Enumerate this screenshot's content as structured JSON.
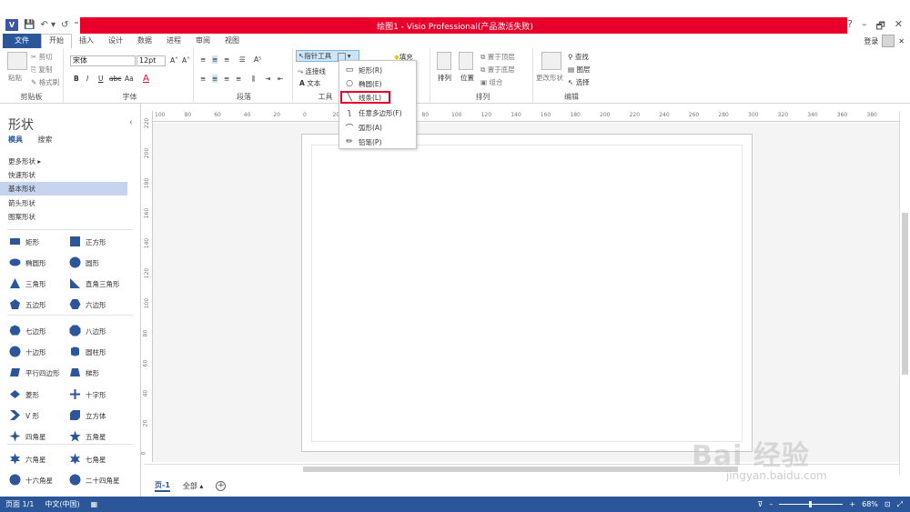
{
  "window": {
    "title": "绘图1 - Visio Professional(产品激活失败)",
    "controls": [
      "?",
      "–",
      "🗗",
      "✕"
    ]
  },
  "qat": {
    "logo": "V",
    "save": "💾",
    "undo": "↶ ▾",
    "redo": "↺",
    "more": "⁼"
  },
  "tabs": [
    {
      "label": "文件",
      "kind": "file"
    },
    {
      "label": "开始",
      "kind": "active"
    },
    {
      "label": "插入"
    },
    {
      "label": "设计"
    },
    {
      "label": "数据"
    },
    {
      "label": "进程"
    },
    {
      "label": "审阅"
    },
    {
      "label": "视图"
    }
  ],
  "account": {
    "signin": "登录",
    "close": "✕"
  },
  "ribbon": {
    "clipboard": {
      "label": "剪贴板",
      "paste": "粘贴",
      "cut": "剪切",
      "copy": "复制",
      "format_painter": "格式刷"
    },
    "font": {
      "label": "字体",
      "font_name": "宋体",
      "font_size": "12pt",
      "bold": "B",
      "italic": "I",
      "underline": "U",
      "strike": "abc",
      "case": "Aa",
      "color": "A",
      "grow": "A˄",
      "shrink": "A˅"
    },
    "paragraph": {
      "label": "段落"
    },
    "tools": {
      "label": "工具",
      "pointer": "指针工具",
      "connector": "连接线",
      "text": "文本"
    },
    "shape_styles": {
      "fill": "填充"
    },
    "arrange": {
      "label": "排列",
      "arrange": "排列",
      "position": "位置",
      "bring_front": "置于顶层",
      "send_back": "置于底层",
      "group": "组合"
    },
    "editing": {
      "label": "编辑",
      "change_shape": "更改形状",
      "find": "查找",
      "layers": "图层",
      "select": "选择"
    }
  },
  "dropdown": [
    {
      "label": "矩形(R)",
      "icon": "rectangle-icon"
    },
    {
      "label": "椭圆(E)",
      "icon": "ellipse-icon"
    },
    {
      "label": "线条(L)",
      "icon": "line-icon",
      "highlighted": true
    },
    {
      "label": "任意多边形(F)",
      "icon": "freeform-icon"
    },
    {
      "label": "弧形(A)",
      "icon": "arc-icon"
    },
    {
      "label": "铅笔(P)",
      "icon": "pencil-icon"
    }
  ],
  "shapes_panel": {
    "title": "形状",
    "tabs": [
      "模具",
      "搜索"
    ],
    "stencils": [
      "更多形状",
      "快速形状",
      "基本形状",
      "箭头形状",
      "图案形状"
    ],
    "selected_stencil": "基本形状",
    "shapes": [
      {
        "label": "矩形"
      },
      {
        "label": "正方形"
      },
      {
        "label": "椭圆形"
      },
      {
        "label": "圆形"
      },
      {
        "label": "三角形"
      },
      {
        "label": "直角三角形"
      },
      {
        "label": "五边形"
      },
      {
        "label": "六边形"
      },
      {
        "label": "七边形"
      },
      {
        "label": "八边形"
      },
      {
        "label": "十边形"
      },
      {
        "label": "圆柱形"
      },
      {
        "label": "平行四边形"
      },
      {
        "label": "梯形"
      },
      {
        "label": "菱形"
      },
      {
        "label": "十字形"
      },
      {
        "label": "V 形"
      },
      {
        "label": "立方体"
      },
      {
        "label": "四角星"
      },
      {
        "label": "五角星"
      },
      {
        "label": "六角星"
      },
      {
        "label": "七角星"
      },
      {
        "label": "十六角星"
      },
      {
        "label": "二十四角星"
      }
    ]
  },
  "rulers": {
    "horizontal": [
      "100",
      "80",
      "60",
      "40",
      "20",
      "0",
      "20",
      "40",
      "60",
      "80",
      "100",
      "120",
      "140",
      "160",
      "180",
      "200",
      "220",
      "240",
      "260",
      "280",
      "300",
      "320",
      "340",
      "360",
      "380"
    ],
    "vertical": [
      "220",
      "200",
      "180",
      "160",
      "140",
      "120",
      "100",
      "80",
      "60",
      "40",
      "20",
      "0"
    ]
  },
  "page_tabs": {
    "current": "页-1",
    "all": "全部 ▴",
    "add": "+"
  },
  "status": {
    "page": "页面 1/1",
    "language": "中文(中国)",
    "zoom": "68%",
    "zoom_level": 0.68
  },
  "watermark": {
    "text": "Bai 经验",
    "sub": "jingyan.baidu.com"
  },
  "colors": {
    "accent": "#2b579a",
    "title_red": "#e8002a",
    "highlight_box": "#e8002a",
    "selected_stencil": "#c5d3ef"
  }
}
